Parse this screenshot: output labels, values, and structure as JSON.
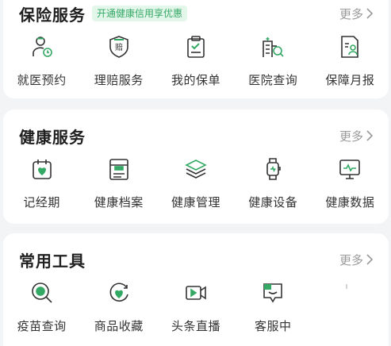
{
  "insurance": {
    "title": "保险服务",
    "promo": "开通健康信用享优惠",
    "more": "更多",
    "items": [
      {
        "label": "就医预约",
        "icon": "doctor-clock-icon"
      },
      {
        "label": "理赔服务",
        "icon": "claim-shield-icon"
      },
      {
        "label": "我的保单",
        "icon": "policy-clipboard-icon"
      },
      {
        "label": "医院查询",
        "icon": "hospital-search-icon"
      },
      {
        "label": "保障月报",
        "icon": "monthly-report-icon"
      }
    ]
  },
  "health": {
    "title": "健康服务",
    "more": "更多",
    "items": [
      {
        "label": "记经期",
        "icon": "calendar-heart-icon"
      },
      {
        "label": "健康档案",
        "icon": "health-file-icon"
      },
      {
        "label": "健康管理",
        "icon": "layers-icon"
      },
      {
        "label": "健康设备",
        "icon": "smartwatch-icon"
      },
      {
        "label": "健康数据",
        "icon": "monitor-pulse-icon"
      }
    ]
  },
  "tools": {
    "title": "常用工具",
    "more": "更多",
    "items": [
      {
        "label": "疫苗查询",
        "icon": "vaccine-search-icon"
      },
      {
        "label": "商品收藏",
        "icon": "favorite-heart-icon"
      },
      {
        "label": "头条直播",
        "icon": "video-camera-icon"
      },
      {
        "label": "客服中",
        "icon": "customer-service-icon"
      }
    ]
  },
  "colors": {
    "accent": "#34a865",
    "icon_stroke": "#333333",
    "promo_bg": "#e3f6ea",
    "more_text": "#9a9a9a"
  }
}
